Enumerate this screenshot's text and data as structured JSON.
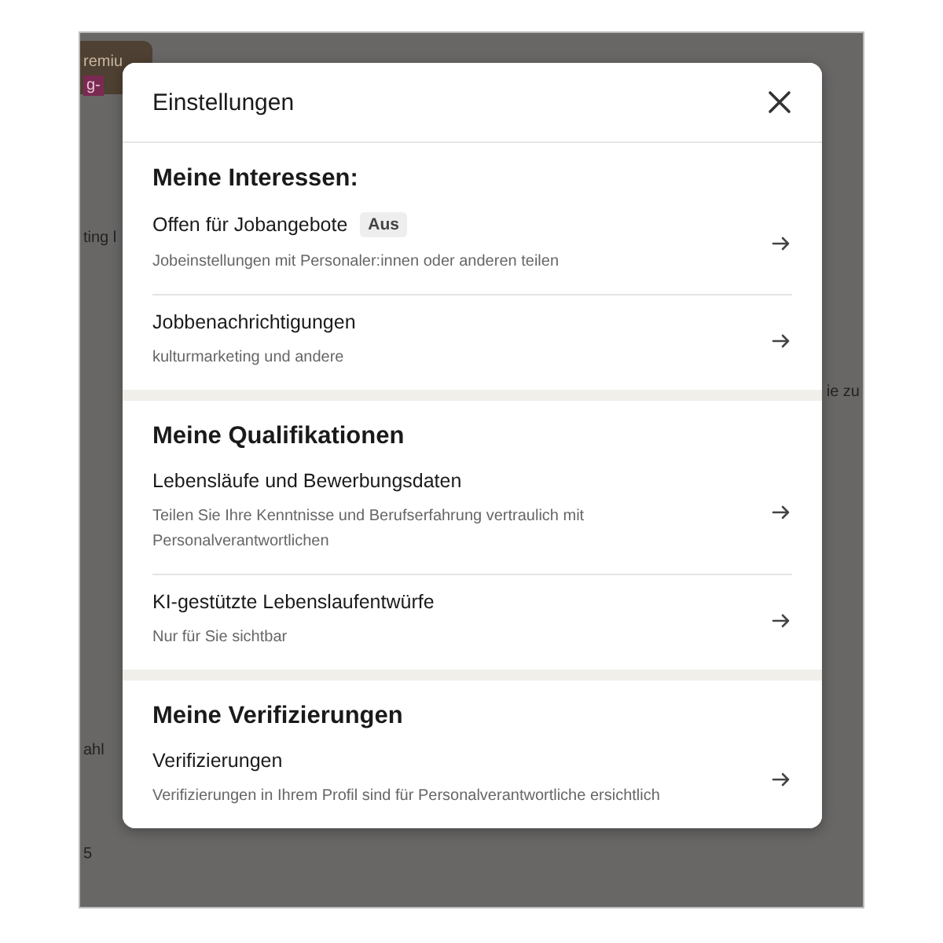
{
  "background": {
    "fragments": [
      "remiu",
      "g-",
      "ting l",
      "ie zu",
      "ahl",
      "5"
    ]
  },
  "dialog": {
    "title": "Einstellungen",
    "sections": [
      {
        "heading": "Meine Interessen:",
        "items": [
          {
            "title": "Offen für Jobangebote",
            "badge": "Aus",
            "subtitle": "Jobeinstellungen mit Personaler:innen oder anderen teilen"
          },
          {
            "title": "Jobbenachrichtigungen",
            "subtitle": "kulturmarketing und andere"
          }
        ]
      },
      {
        "heading": "Meine Qualifikationen",
        "items": [
          {
            "title": "Lebensläufe und Bewerbungsdaten",
            "subtitle": "Teilen Sie Ihre Kenntnisse und Berufserfahrung vertraulich mit Personalverantwortlichen"
          },
          {
            "title": "KI-gestützte Lebenslaufentwürfe",
            "subtitle": "Nur für Sie sichtbar"
          }
        ]
      },
      {
        "heading": "Meine Verifizierungen",
        "items": [
          {
            "title": "Verifizierungen",
            "subtitle": "Verifizierungen in Ihrem Profil sind für Personalverantwortliche ersichtlich"
          }
        ]
      }
    ]
  }
}
